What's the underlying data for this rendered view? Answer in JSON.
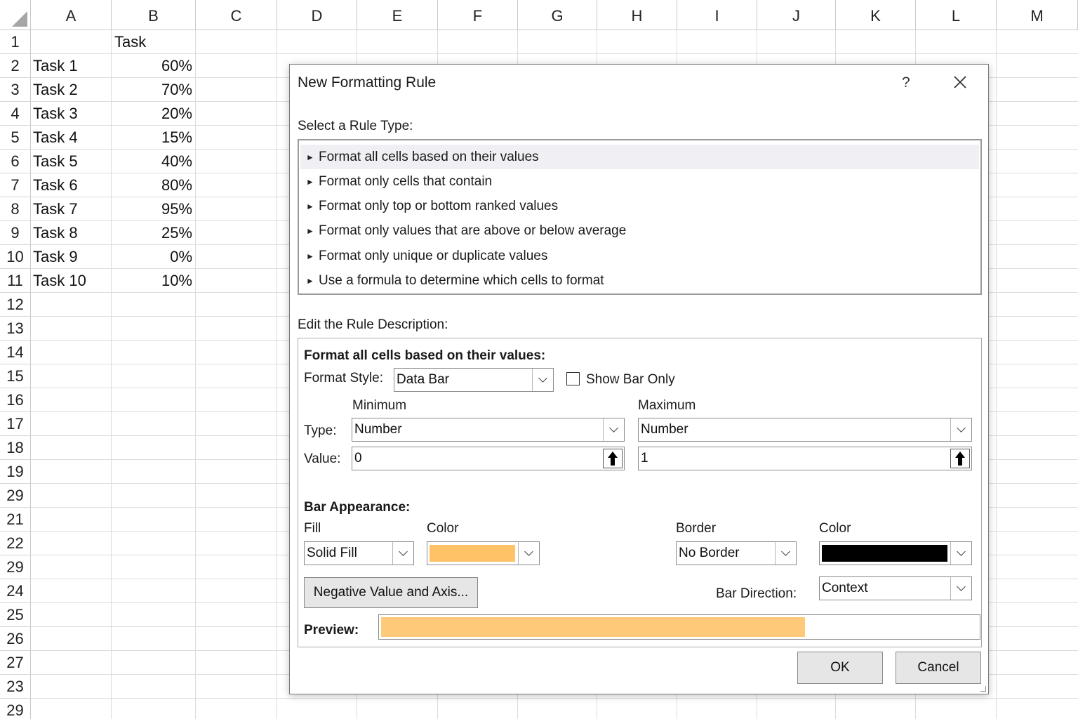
{
  "sheet": {
    "columns": [
      "A",
      "B",
      "C",
      "D",
      "E",
      "F",
      "G",
      "H",
      "I",
      "J",
      "K",
      "L",
      "M"
    ],
    "rows": [
      "1",
      "2",
      "3",
      "4",
      "5",
      "6",
      "7",
      "8",
      "9",
      "10",
      "11",
      "12",
      "13",
      "14",
      "15",
      "16",
      "17",
      "18",
      "19",
      "29",
      "21",
      "22",
      "29",
      "24",
      "25",
      "26",
      "27",
      "23",
      "29"
    ],
    "header_cell": "Task",
    "tasks": [
      {
        "name": "Task 1",
        "value": "60%"
      },
      {
        "name": "Task 2",
        "value": "70%"
      },
      {
        "name": "Task 3",
        "value": "20%"
      },
      {
        "name": "Task 4",
        "value": "15%"
      },
      {
        "name": "Task 5",
        "value": "40%"
      },
      {
        "name": "Task 6",
        "value": "80%"
      },
      {
        "name": "Task 7",
        "value": "95%"
      },
      {
        "name": "Task 8",
        "value": "25%"
      },
      {
        "name": "Task 9",
        "value": "0%"
      },
      {
        "name": "Task 10",
        "value": "10%"
      }
    ]
  },
  "dialog": {
    "title": "New Formatting Rule",
    "help": "?",
    "select_rule_type_label": "Select a Rule Type:",
    "rule_types": [
      "Format all cells based on their values",
      "Format only cells that contain",
      "Format only top or bottom ranked values",
      "Format only values that are above or below average",
      "Format only unique or duplicate values",
      "Use a formula to determine which cells to format"
    ],
    "selected_rule_type": 0,
    "edit_description_label": "Edit the Rule Description:",
    "section_heading": "Format all cells based on their values:",
    "format_style_label": "Format Style:",
    "format_style_value": "Data Bar",
    "show_bar_only_label": "Show Bar Only",
    "show_bar_only_checked": false,
    "minimum_label": "Minimum",
    "maximum_label": "Maximum",
    "type_label": "Type:",
    "value_label": "Value:",
    "min_type": "Number",
    "max_type": "Number",
    "min_value": "0",
    "max_value": "1",
    "bar_appearance_label": "Bar Appearance:",
    "fill_label": "Fill",
    "fill_color_label": "Color",
    "border_label": "Border",
    "border_color_label": "Color",
    "fill_value": "Solid Fill",
    "border_value": "No Border",
    "fill_color": "#ffc266",
    "border_color": "#000000",
    "negative_button": "Negative Value and Axis...",
    "bar_direction_label": "Bar Direction:",
    "bar_direction_value": "Context",
    "preview_label": "Preview:",
    "preview_fill_fraction": 0.71,
    "preview_color": "#ffc97a",
    "ok_label": "OK",
    "cancel_label": "Cancel"
  }
}
